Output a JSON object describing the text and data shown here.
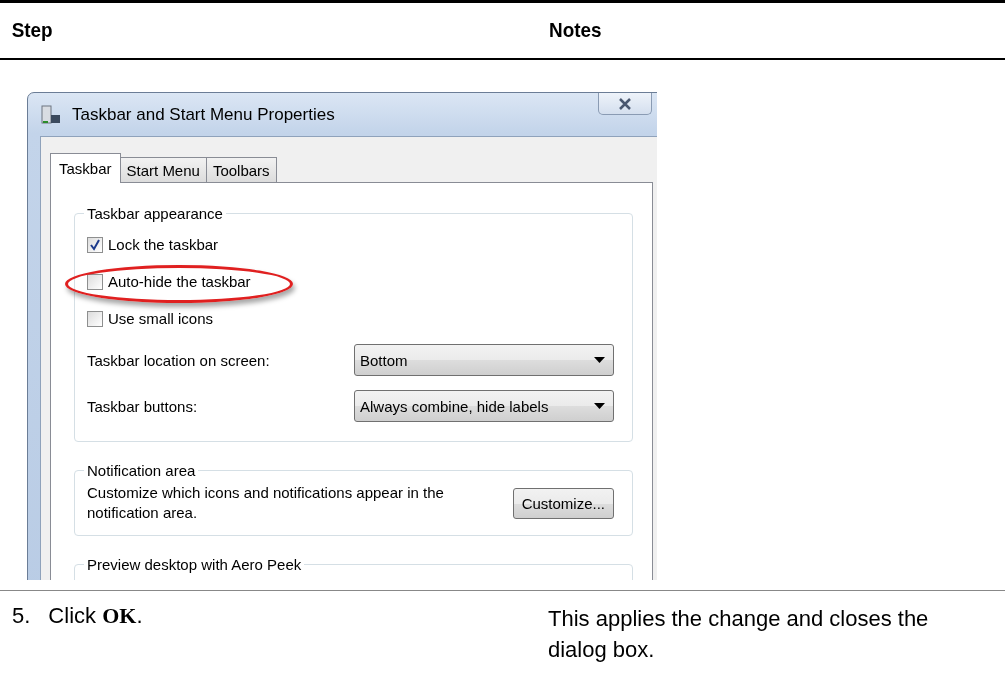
{
  "table": {
    "columns": [
      "Step",
      "Notes"
    ]
  },
  "dialog": {
    "title": "Taskbar and Start Menu Properties",
    "tabs": [
      {
        "label": "Taskbar",
        "selected": true
      },
      {
        "label": "Start Menu",
        "selected": false
      },
      {
        "label": "Toolbars",
        "selected": false
      }
    ],
    "groups": [
      {
        "title": "Taskbar appearance",
        "rows": [
          {
            "kind": "checkbox",
            "label": "Lock the taskbar",
            "checked": true,
            "highlighted": false
          },
          {
            "kind": "checkbox",
            "label": "Auto-hide the taskbar",
            "checked": false,
            "highlighted": true
          },
          {
            "kind": "checkbox",
            "label": "Use small icons",
            "checked": false,
            "highlighted": false
          },
          {
            "kind": "dropdown",
            "label": "Taskbar location on screen:",
            "value": "Bottom"
          },
          {
            "kind": "dropdown",
            "label": "Taskbar buttons:",
            "value": "Always combine, hide labels"
          }
        ]
      },
      {
        "title": "Notification area",
        "rows": [
          {
            "kind": "text-button",
            "text": "Customize which icons and notifications appear in the notification area.",
            "button": "Customize..."
          }
        ]
      },
      {
        "title": "Preview desktop with Aero Peek"
      }
    ]
  },
  "step": {
    "number": "5.",
    "text": "Click **OK**.",
    "note": "This applies the change and closes the dialog box."
  }
}
